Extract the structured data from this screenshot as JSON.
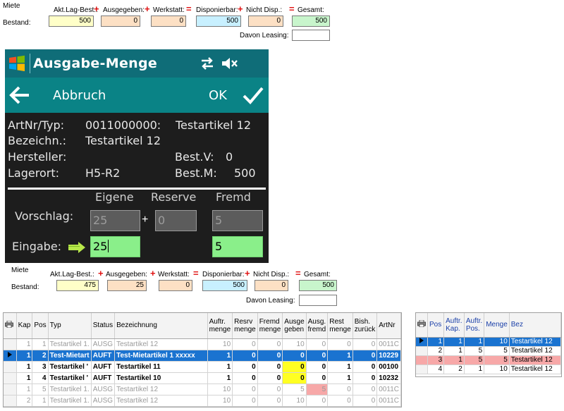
{
  "top_panel": {
    "title": "Miete",
    "row_label": "Bestand:",
    "akt_lag_label": "Akt.Lag-Best.:",
    "ausgegeben_label": "Ausgegeben:",
    "werkstatt_label": "Werkstatt:",
    "disponierbar_label": "Disponierbar:",
    "nicht_disp_label": "Nicht Disp.:",
    "gesamt_label": "Gesamt:",
    "davon_leasing_label": "Davon Leasing:",
    "akt_lag_value": "500",
    "ausgegeben_value": "0",
    "werkstatt_value": "0",
    "disponierbar_value": "500",
    "nicht_disp_value": "0",
    "gesamt_value": "500",
    "davon_leasing_value": "",
    "op_plus": "+",
    "op_equals": "="
  },
  "mobile": {
    "title": "Ausgabe-Menge",
    "back_label": "Abbruch",
    "ok_label": "OK",
    "artnr_label": "ArtNr/Typ:",
    "artnr_value": "0011000000:",
    "artnr_type": "Testartikel 12",
    "bezeichn_label": "Bezeichn.:",
    "bezeichn_value": "Testartikel 12",
    "hersteller_label": "Hersteller:",
    "best_v_label": "Best.V:",
    "best_v_value": "0",
    "lagerort_label": "Lagerort:",
    "lagerort_value": "H5-R2",
    "best_m_label": "Best.M:",
    "best_m_value": "500",
    "col_eigene": "Eigene",
    "col_reserve": "Reserve",
    "col_fremd": "Fremd",
    "vorschlag_label": "Vorschlag:",
    "vorschlag_eigene": "25",
    "vorschlag_reserve": "0",
    "vorschlag_fremd": "5",
    "plus": "+",
    "eingabe_label": "Eingabe:",
    "eingabe_eigene": "25",
    "eingabe_fremd": "5"
  },
  "bottom_panel": {
    "title": "Miete",
    "row_label": "Bestand:",
    "akt_lag_label": "Akt.Lag-Best.:",
    "ausgegeben_label": "Ausgegeben:",
    "werkstatt_label": "Werkstatt:",
    "disponierbar_label": "Disponierbar:",
    "nicht_disp_label": "Nicht Disp.:",
    "gesamt_label": "Gesamt:",
    "davon_leasing_label": "Davon Leasing:",
    "akt_lag_value": "475",
    "ausgegeben_value": "25",
    "werkstatt_value": "0",
    "disponierbar_value": "500",
    "nicht_disp_value": "0",
    "gesamt_value": "500",
    "davon_leasing_value": "",
    "op_plus": "+",
    "op_equals": "="
  },
  "grid": {
    "headers": [
      "Kap",
      "Pos",
      "Typ",
      "Status",
      "Bezeichnung",
      "Auftr. menge",
      "Resrv menge",
      "Fremd menge",
      "Ausge geben",
      "Ausg. fremd",
      "Rest menge",
      "Bish. zurück",
      "ArtNr"
    ],
    "rows": [
      {
        "kap": "1",
        "pos": "1",
        "typ": "Testartikel 1.",
        "status": "AUSG",
        "bez": "Testartikel 12",
        "auftr": "10",
        "resrv": "0",
        "fremd": "0",
        "ausge": "10",
        "ausgf": "0",
        "rest": "0",
        "bish": "0",
        "artnr": "0011C"
      },
      {
        "kap": "1",
        "pos": "2",
        "typ": "Test-Mietart",
        "status": "AUFT",
        "bez": "Test-Mietartikel 1 xxxxx",
        "auftr": "1",
        "resrv": "0",
        "fremd": "0",
        "ausge": "0",
        "ausgf": "0",
        "rest": "1",
        "bish": "0",
        "artnr": "10229"
      },
      {
        "kap": "1",
        "pos": "3",
        "typ": "Testartikel '",
        "status": "AUFT",
        "bez": "Testartikel 11",
        "auftr": "1",
        "resrv": "0",
        "fremd": "0",
        "ausge": "0",
        "ausgf": "0",
        "rest": "1",
        "bish": "0",
        "artnr": "00100"
      },
      {
        "kap": "1",
        "pos": "4",
        "typ": "Testartikel '",
        "status": "AUFT",
        "bez": "Testartikel 10",
        "auftr": "1",
        "resrv": "0",
        "fremd": "0",
        "ausge": "0",
        "ausgf": "0",
        "rest": "1",
        "bish": "0",
        "artnr": "10232"
      },
      {
        "kap": "1",
        "pos": "5",
        "typ": "Testartikel 1.",
        "status": "AUSG",
        "bez": "Testartikel 12",
        "auftr": "10",
        "resrv": "0",
        "fremd": "0",
        "ausge": "5",
        "ausgf": "5",
        "rest": "0",
        "bish": "0",
        "artnr": "0011C"
      },
      {
        "kap": "2",
        "pos": "1",
        "typ": "Testartikel 1.",
        "status": "AUSG",
        "bez": "Testartikel 12",
        "auftr": "10",
        "resrv": "0",
        "fremd": "0",
        "ausge": "10",
        "ausgf": "0",
        "rest": "0",
        "bish": "0",
        "artnr": "0011C"
      }
    ]
  },
  "side_grid": {
    "headers": [
      "Pos",
      "Auftr. Kap.",
      "Auftr. Pos.",
      "Menge",
      "Bez"
    ],
    "rows": [
      {
        "pos": "1",
        "kap": "1",
        "apos": "1",
        "menge": "10",
        "bez": "Testartikel 12"
      },
      {
        "pos": "2",
        "kap": "1",
        "apos": "5",
        "menge": "5",
        "bez": "Testartikel 12"
      },
      {
        "pos": "3",
        "kap": "1",
        "apos": "5",
        "menge": "5",
        "bez": "Testartikel 12"
      },
      {
        "pos": "4",
        "kap": "2",
        "apos": "1",
        "menge": "10",
        "bez": "Testartikel 12"
      }
    ]
  },
  "colors": {
    "title_bar": "#0f6d78",
    "command_bar": "#0a8386",
    "selection": "#1a73d0",
    "highlight_yellow": "#ffff22",
    "highlight_pink": "#f7a8a8",
    "input_green": "#8aef8a"
  },
  "icons": [
    "windows-logo-icon",
    "connectivity-icon",
    "speaker-muted-icon",
    "back-arrow-icon",
    "checkmark-icon",
    "arrow-right-icon",
    "printer-icon",
    "row-pointer-icon"
  ]
}
